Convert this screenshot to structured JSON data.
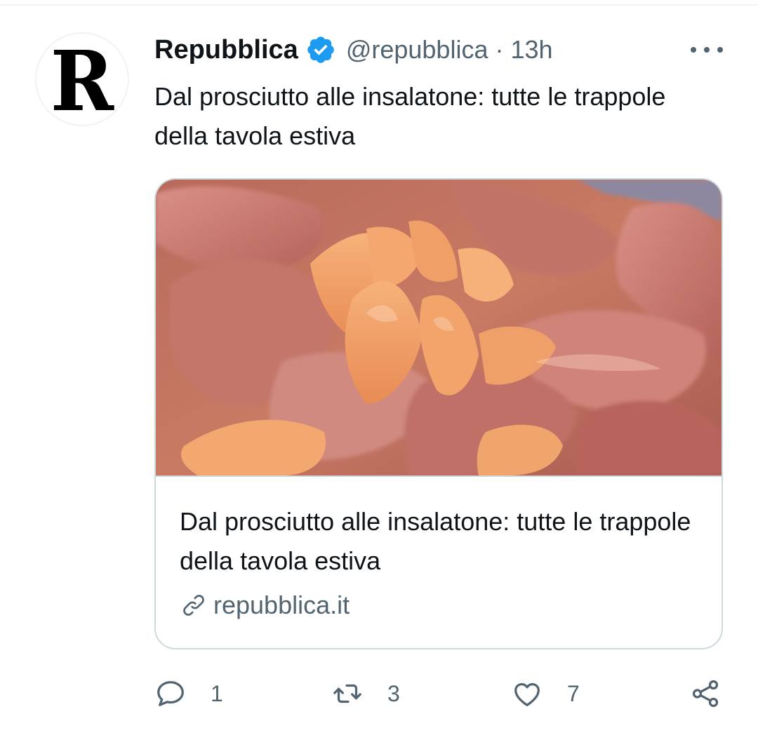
{
  "author": {
    "display_name": "Repubblica",
    "handle": "@repubblica",
    "separator": "·",
    "time": "13h",
    "avatar_letter": "R",
    "verified": true
  },
  "tweet": {
    "text": "Dal prosciutto alle insalatone: tutte le trappole della tavola estiva"
  },
  "card": {
    "title": "Dal prosciutto alle insalatone: tutte le trappole della tavola estiva",
    "domain": "repubblica.it",
    "image_subject": "prosciutto-and-melon-photo"
  },
  "actions": {
    "reply_count": "1",
    "retweet_count": "3",
    "like_count": "7"
  },
  "colors": {
    "text_primary": "#0f1419",
    "text_secondary": "#536471",
    "verified_blue": "#1d9bf0",
    "border": "#cfd9de"
  },
  "icons": {
    "verified": "verified-badge-icon",
    "more": "more-options-icon",
    "link": "link-icon",
    "reply": "reply-icon",
    "retweet": "retweet-icon",
    "like": "heart-icon",
    "share": "share-icon"
  }
}
